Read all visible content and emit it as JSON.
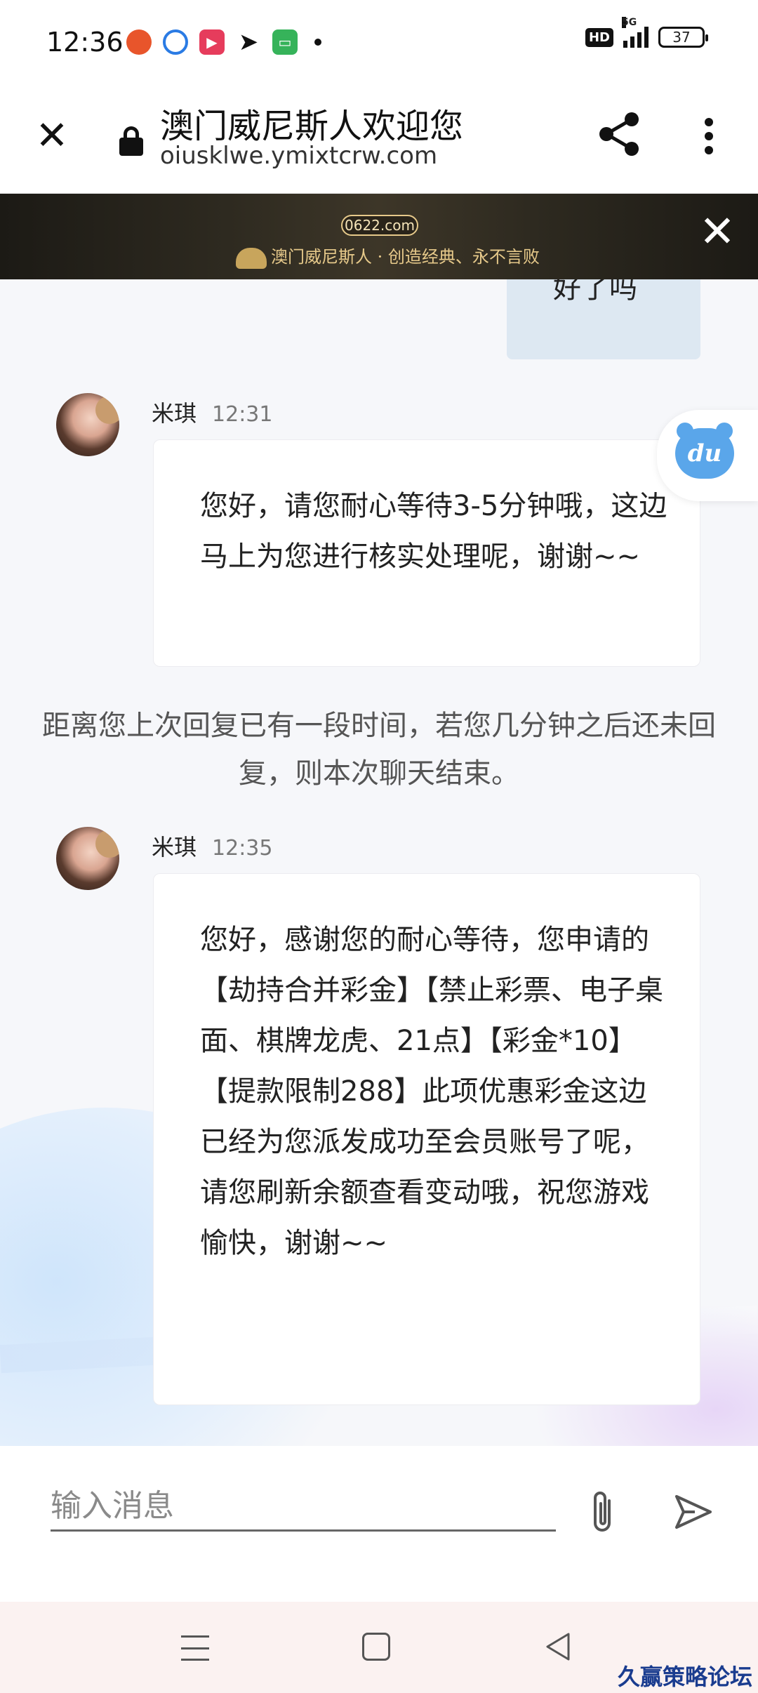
{
  "status_bar": {
    "time": "12:36",
    "hd": "HD",
    "network": "5G",
    "battery": "37"
  },
  "browser": {
    "title": "澳门威尼斯人欢迎您",
    "url": "oiusklwe.ymixtcrw.com"
  },
  "banner": {
    "domain": "0622.com",
    "slogan": "澳门威尼斯人 · 创造经典、永不言败"
  },
  "chat": {
    "sent_partial": "好了吗",
    "messages": [
      {
        "sender": "米琪",
        "time": "12:31",
        "text": "您好，请您耐心等待3-5分钟哦，这边马上为您进行核实处理呢，谢谢~~"
      },
      {
        "sender": "米琪",
        "time": "12:35",
        "text": "您好，感谢您的耐心等待，您申请的【劫持合并彩金】【禁止彩票、电子桌面、棋牌龙虎、21点】【彩金*10】【提款限制288】此项优惠彩金这边已经为您派发成功至会员账号了呢，请您刷新余额查看变动哦，祝您游戏愉快，谢谢~~"
      }
    ],
    "system_note": "距离您上次回复已有一段时间，若您几分钟之后还未回复，则本次聊天结束。",
    "du_label": "du"
  },
  "input": {
    "placeholder": "输入消息"
  },
  "watermark": "久赢策略论坛"
}
